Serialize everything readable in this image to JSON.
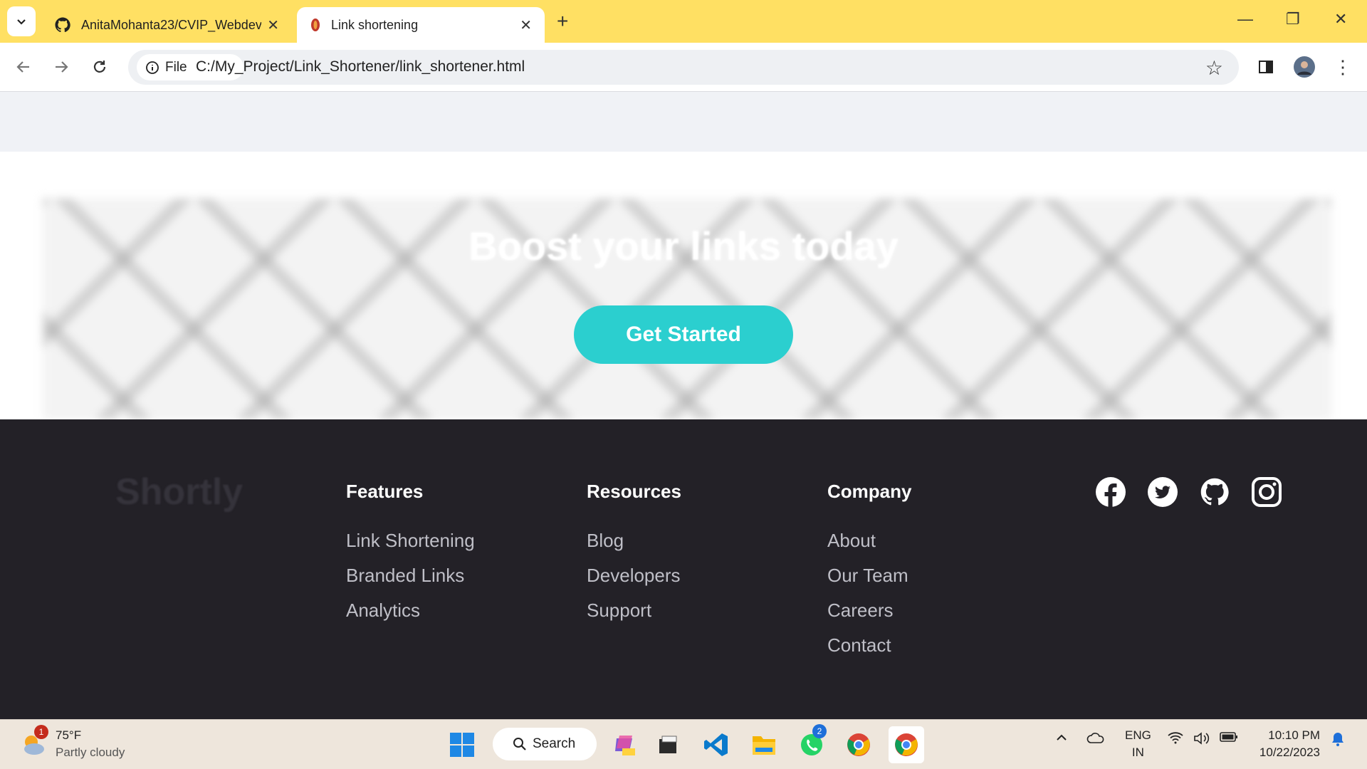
{
  "browser": {
    "tabs": [
      {
        "title": "AnitaMohanta23/CVIP_Webdev",
        "active": false
      },
      {
        "title": "Link shortening",
        "active": true
      }
    ],
    "address": {
      "scheme_label": "File",
      "url": "C:/My_Project/Link_Shortener/link_shortener.html"
    }
  },
  "hero": {
    "title": "Boost your links today",
    "cta_label": "Get Started"
  },
  "footer": {
    "logo": "Shortly",
    "columns": [
      {
        "heading": "Features",
        "links": [
          "Link Shortening",
          "Branded Links",
          "Analytics"
        ]
      },
      {
        "heading": "Resources",
        "links": [
          "Blog",
          "Developers",
          "Support"
        ]
      },
      {
        "heading": "Company",
        "links": [
          "About",
          "Our Team",
          "Careers",
          "Contact"
        ]
      }
    ],
    "social": [
      "facebook-icon",
      "twitter-icon",
      "github-icon",
      "instagram-icon"
    ]
  },
  "taskbar": {
    "weather": {
      "temp": "75°F",
      "condition": "Partly cloudy",
      "badge": "1"
    },
    "search_label": "Search",
    "whatsapp_badge": "2",
    "lang": {
      "line1": "ENG",
      "line2": "IN"
    },
    "time": "10:10 PM",
    "date": "10/22/2023"
  },
  "colors": {
    "accent": "#2bcfcf",
    "footer_bg": "#232127",
    "tabbar_bg": "#ffe063"
  }
}
